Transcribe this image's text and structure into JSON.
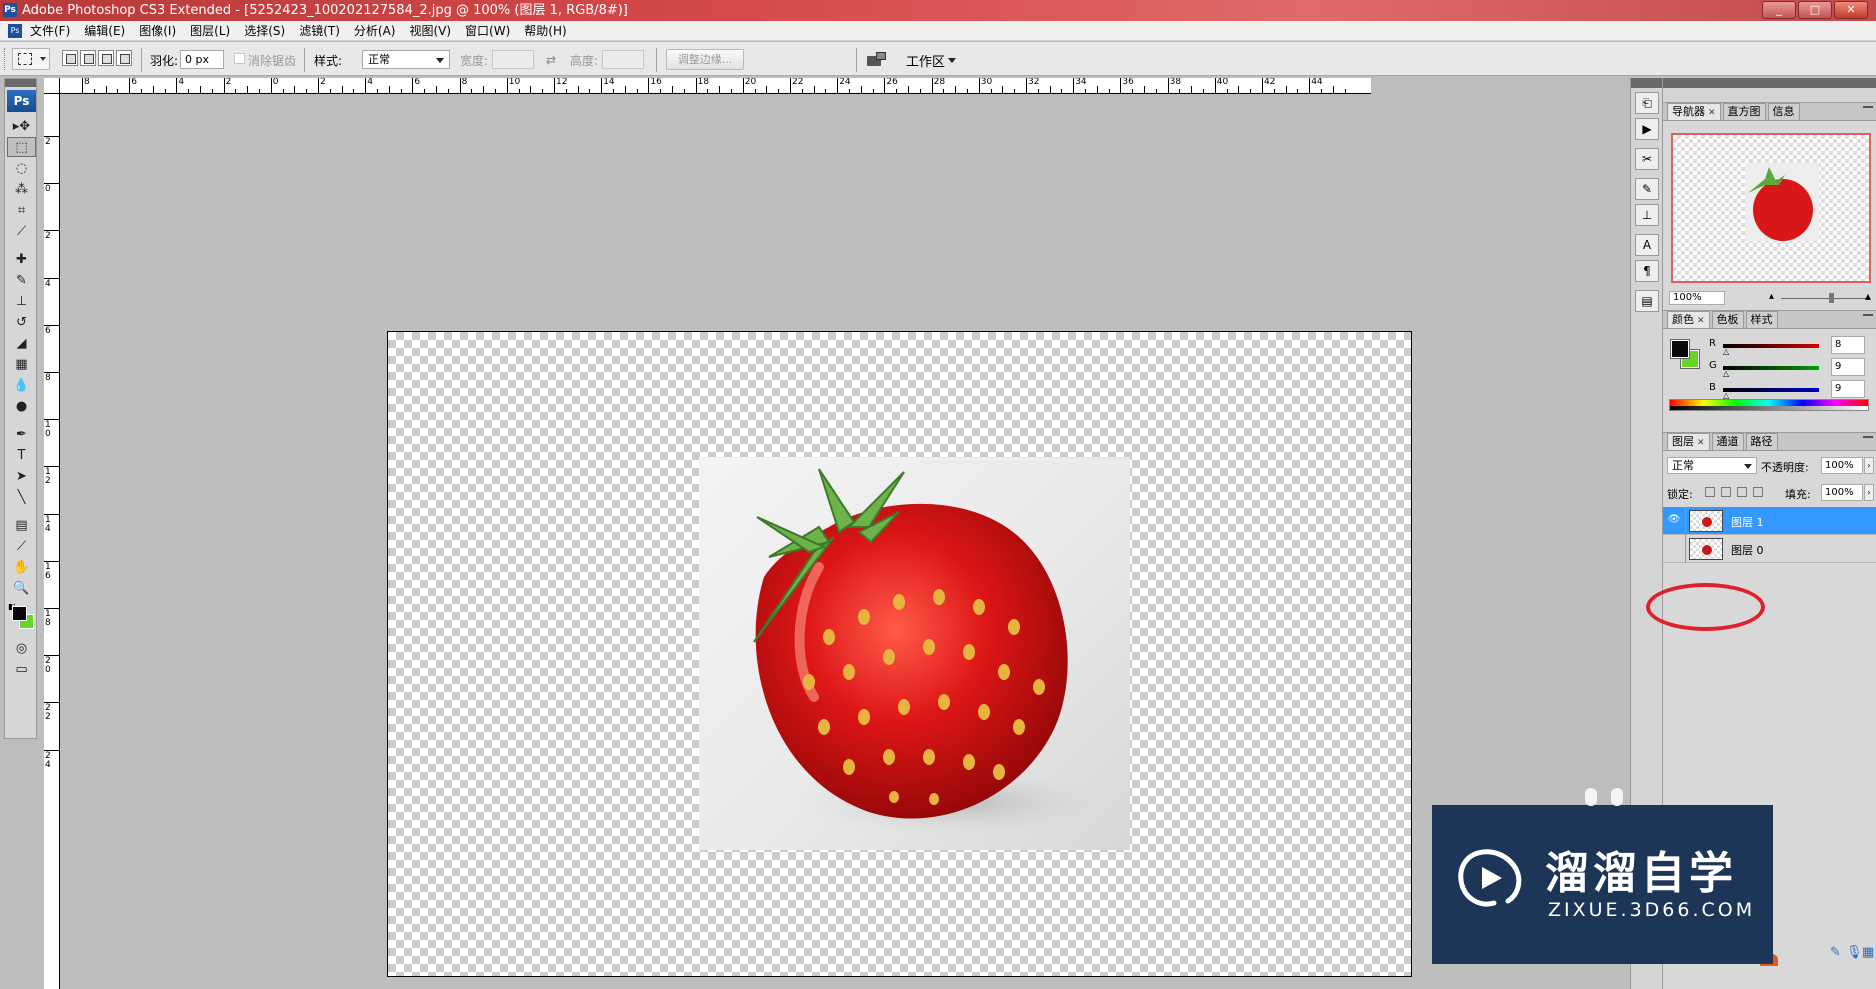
{
  "window": {
    "app_badge": "Ps",
    "title": "Adobe Photoshop CS3 Extended - [5252423_100202127584_2.jpg @ 100% (图层 1, RGB/8#)]",
    "controls": [
      "_",
      "□",
      "✕"
    ]
  },
  "menu": {
    "items": [
      "文件(F)",
      "编辑(E)",
      "图像(I)",
      "图层(L)",
      "选择(S)",
      "滤镜(T)",
      "分析(A)",
      "视图(V)",
      "窗口(W)",
      "帮助(H)"
    ]
  },
  "options_bar": {
    "feather_label": "羽化:",
    "feather_value": "0 px",
    "antialias_label": "消除锯齿",
    "style_label": "样式:",
    "style_value": "正常",
    "width_label": "宽度:",
    "height_label": "高度:",
    "refine_edge_label": "调整边缘...",
    "workspace_label": "工作区"
  },
  "toolbox": {
    "logo": "Ps",
    "tools": [
      {
        "name": "move-tool",
        "glyph": "▸✥"
      },
      {
        "name": "rect-marquee-tool",
        "glyph": "⬚",
        "active": true
      },
      {
        "name": "lasso-tool",
        "glyph": "◌"
      },
      {
        "name": "magic-wand-tool",
        "glyph": "⁂"
      },
      {
        "name": "crop-tool",
        "glyph": "⌗"
      },
      {
        "name": "slice-tool",
        "glyph": "⟋"
      },
      {
        "name": "healing-brush-tool",
        "glyph": "✚"
      },
      {
        "name": "brush-tool",
        "glyph": "✎"
      },
      {
        "name": "clone-stamp-tool",
        "glyph": "⊥"
      },
      {
        "name": "history-brush-tool",
        "glyph": "↺"
      },
      {
        "name": "eraser-tool",
        "glyph": "◢"
      },
      {
        "name": "gradient-tool",
        "glyph": "▦"
      },
      {
        "name": "blur-tool",
        "glyph": "💧"
      },
      {
        "name": "dodge-tool",
        "glyph": "●"
      },
      {
        "name": "pen-tool",
        "glyph": "✒"
      },
      {
        "name": "type-tool",
        "glyph": "T"
      },
      {
        "name": "path-selection-tool",
        "glyph": "➤"
      },
      {
        "name": "line-tool",
        "glyph": "╲"
      },
      {
        "name": "notes-tool",
        "glyph": "▤"
      },
      {
        "name": "eyedropper-tool",
        "glyph": "⟋"
      },
      {
        "name": "hand-tool",
        "glyph": "✋"
      },
      {
        "name": "zoom-tool",
        "glyph": "🔍"
      }
    ],
    "bottom_tools": [
      {
        "name": "quick-mask-tool",
        "glyph": "◎"
      },
      {
        "name": "screen-mode-tool",
        "glyph": "▭"
      }
    ],
    "foreground_color": "#080909",
    "background_color": "#66d52a"
  },
  "rulers": {
    "top_labels": [
      "8",
      "6",
      "4",
      "2",
      "0",
      "2",
      "4",
      "6",
      "8",
      "10",
      "12",
      "14",
      "16",
      "18",
      "20",
      "22",
      "24",
      "26",
      "28",
      "30",
      "32",
      "34",
      "36",
      "38",
      "40",
      "42",
      "44"
    ],
    "left_labels": [
      "2",
      "0",
      "2",
      "4",
      "6",
      "8",
      "1 0",
      "1 2",
      "1 4",
      "1 6",
      "1 8",
      "2 0",
      "2 2",
      "2 4"
    ]
  },
  "navigator_panel": {
    "tabs": [
      "导航器",
      "直方图",
      "信息"
    ],
    "zoom": "100%"
  },
  "color_panel": {
    "tabs": [
      "颜色",
      "色板",
      "样式"
    ],
    "channels": [
      {
        "label": "R",
        "value": "8",
        "color": "#d40000"
      },
      {
        "label": "G",
        "value": "9",
        "color": "#00a000"
      },
      {
        "label": "B",
        "value": "9",
        "color": "#0000c8"
      }
    ]
  },
  "layers_panel": {
    "tabs": [
      "图层",
      "通道",
      "路径"
    ],
    "blend_mode": "正常",
    "opacity_label": "不透明度:",
    "opacity_value": "100%",
    "lock_label": "锁定:",
    "fill_label": "填充:",
    "fill_value": "100%",
    "layers": [
      {
        "name": "图层 1",
        "visible": true,
        "selected": true
      },
      {
        "name": "图层 0",
        "visible": false,
        "selected": false
      }
    ]
  },
  "watermark": {
    "brand": "溜溜自学",
    "url": "ZIXUE.3D66.COM",
    "color": "#1d3557"
  },
  "accent_colors": {
    "selection": "#3399ff",
    "highlight_ring": "#e0202a"
  }
}
